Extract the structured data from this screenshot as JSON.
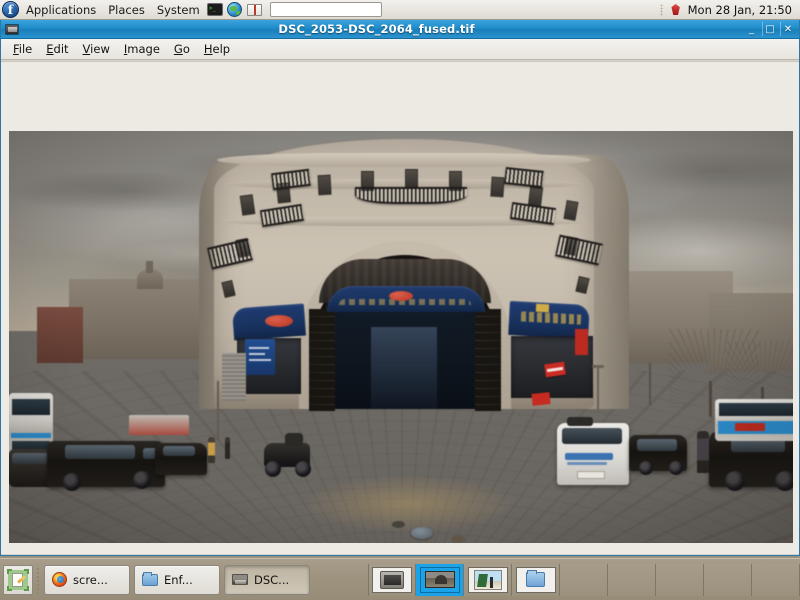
{
  "top_panel": {
    "logo_icon": "fedora-logo-icon",
    "menus": [
      {
        "label": "Applications"
      },
      {
        "label": "Places"
      },
      {
        "label": "System"
      }
    ],
    "launchers": [
      {
        "icon": "terminal-icon",
        "name": "terminal-launcher"
      },
      {
        "icon": "web-browser-icon",
        "name": "browser-launcher"
      },
      {
        "icon": "help-book-icon",
        "name": "help-launcher"
      }
    ],
    "entry_value": "",
    "entry_placeholder": "",
    "tray_icon": "red-gem-icon",
    "clock": "Mon 28 Jan, 21:50"
  },
  "window": {
    "title": "DSC_2053-DSC_2064_fused.tif",
    "icon": "image-viewer-icon",
    "controls": {
      "minimize": "_",
      "maximize": "□",
      "close": "✕"
    },
    "menubar": [
      {
        "label": "File",
        "mnemonic": "F",
        "rest": "ile"
      },
      {
        "label": "Edit",
        "mnemonic": "E",
        "rest": "dit"
      },
      {
        "label": "View",
        "mnemonic": "V",
        "rest": "iew"
      },
      {
        "label": "Image",
        "mnemonic": "I",
        "rest": "mage"
      },
      {
        "label": "Go",
        "mnemonic": "G",
        "rest": "o"
      },
      {
        "label": "Help",
        "mnemonic": "H",
        "rest": "elp"
      }
    ],
    "canvas": {
      "background_color": "#edeae4",
      "image": {
        "name": "panorama-photograph",
        "description": "360-degree fisheye street panorama of a city corner with a large stone building and arched entrance",
        "alt_text": "Panoramic street scene, overcast sky, black taxis, white van, double-decker bus, pedestrians, paved footpath"
      }
    }
  },
  "bottom_panel": {
    "show_desktop_icon": "show-desktop-icon",
    "tasks": [
      {
        "label": "scre...",
        "icon": "firefox-icon",
        "active": false
      },
      {
        "label": "Enf...",
        "icon": "folder-icon",
        "active": false
      },
      {
        "label": "DSC...",
        "icon": "image-icon",
        "active": true
      }
    ],
    "workspaces": [
      {
        "index": 1,
        "thumb": "terminal-window-thumb",
        "active": false
      },
      {
        "index": 2,
        "thumb": "panorama-window-thumb",
        "active": true
      },
      {
        "index": 3,
        "thumb": "photo-window-thumb",
        "active": false
      },
      {
        "index": 4,
        "thumb": "folder-window-thumb",
        "active": false
      },
      {
        "index": 5,
        "thumb": "",
        "active": false
      },
      {
        "index": 6,
        "thumb": "",
        "active": false
      },
      {
        "index": 7,
        "thumb": "",
        "active": false
      },
      {
        "index": 8,
        "thumb": "",
        "active": false
      },
      {
        "index": 9,
        "thumb": "",
        "active": false
      }
    ]
  },
  "colors": {
    "panel_top": "#e9e6e0",
    "panel_bottom": "#9e9480",
    "titlebar": "#1e8cc9",
    "accent_active": "#1aa3e8",
    "canvas": "#edeae4"
  }
}
